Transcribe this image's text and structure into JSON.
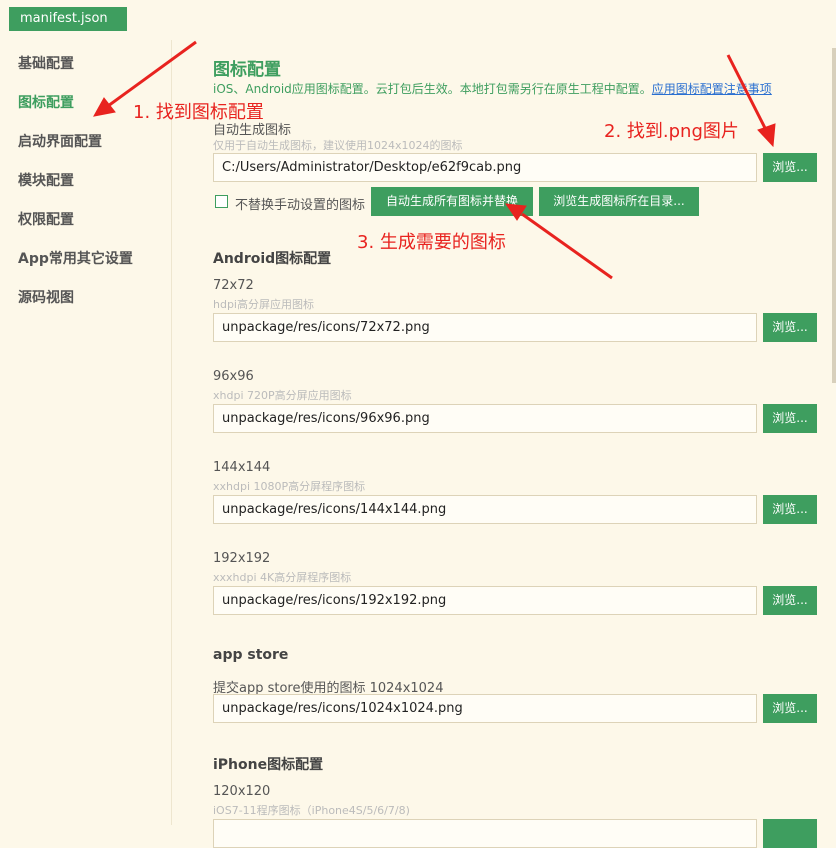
{
  "tab": "manifest.json",
  "sidebar": {
    "items": [
      {
        "label": "基础配置"
      },
      {
        "label": "图标配置"
      },
      {
        "label": "启动界面配置"
      },
      {
        "label": "模块配置"
      },
      {
        "label": "权限配置"
      },
      {
        "label": "App常用其它设置"
      },
      {
        "label": "源码视图"
      }
    ],
    "active": 1
  },
  "main": {
    "title": "图标配置",
    "desc": "iOS、Android应用图标配置。云打包后生效。本地打包需另行在原生工程中配置。",
    "desc_link": "应用图标配置注意事项",
    "auto": {
      "label": "自动生成图标",
      "hint": "仅用于自动生成图标，建议使用1024x1024的图标",
      "value": "C:/Users/Administrator/Desktop/e62f9cab.png",
      "checkbox_label": "不替换手动设置的图标",
      "generate_button": "自动生成所有图标并替换",
      "browse_dir_button": "浏览生成图标所在目录..."
    },
    "browse_label": "浏览...",
    "android": {
      "title": "Android图标配置",
      "items": [
        {
          "label": "72x72",
          "hint": "hdpi高分屏应用图标",
          "value": "unpackage/res/icons/72x72.png"
        },
        {
          "label": "96x96",
          "hint": "xhdpi 720P高分屏应用图标",
          "value": "unpackage/res/icons/96x96.png"
        },
        {
          "label": "144x144",
          "hint": "xxhdpi 1080P高分屏程序图标",
          "value": "unpackage/res/icons/144x144.png"
        },
        {
          "label": "192x192",
          "hint": "xxxhdpi 4K高分屏程序图标",
          "value": "unpackage/res/icons/192x192.png"
        }
      ]
    },
    "appstore": {
      "title": "app store",
      "label": "提交app store使用的图标 1024x1024",
      "value": "unpackage/res/icons/1024x1024.png"
    },
    "iphone": {
      "title": "iPhone图标配置",
      "label": "120x120",
      "hint": "iOS7-11程序图标（iPhone4S/5/6/7/8)"
    }
  },
  "annotations": [
    "1. 找到图标配置",
    "2. 找到.png图片",
    "3. 生成需要的图标"
  ],
  "colors": {
    "accent": "#3e9e5f",
    "annotation": "#e8231f",
    "background": "#fdf8e9"
  }
}
